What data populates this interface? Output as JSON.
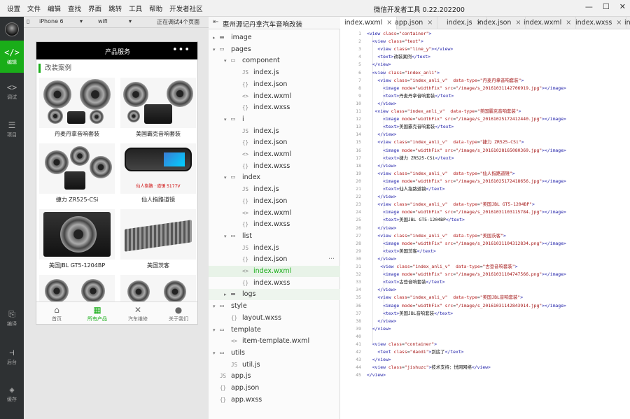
{
  "menu": [
    "设置",
    "文件",
    "编辑",
    "查找",
    "界面",
    "跳转",
    "工具",
    "帮助",
    "开发者社区"
  ],
  "app_title": "微信开发者工具 0.22.202200",
  "window_controls": [
    "minimize-icon",
    "maximize-icon",
    "close-icon"
  ],
  "leftbar": {
    "items": [
      {
        "label": "编辑",
        "icon": "code-icon",
        "active": true
      },
      {
        "label": "调试",
        "icon": "debug-icon",
        "active": false
      },
      {
        "label": "项目",
        "icon": "project-icon",
        "active": false
      },
      {
        "label": "编译",
        "icon": "compile-icon",
        "active": false
      },
      {
        "label": "后台",
        "icon": "backend-icon",
        "active": false
      },
      {
        "label": "缓存",
        "icon": "cache-icon",
        "active": false
      }
    ]
  },
  "simulator": {
    "device": "iPhone 6",
    "network": "wifi",
    "debug_status": "正在调试4个页面",
    "nav_title": "产品服务",
    "nav_menu": "•••",
    "section_title": "改装案例",
    "cards": [
      {
        "label": "丹麦丹拿音响套装"
      },
      {
        "label": "美国霸克音响套装"
      },
      {
        "label": "捷力 ZR525-CSi"
      },
      {
        "label": "仙人指路道镜",
        "banner": "仙人指路 · 道镜 5177V"
      },
      {
        "label": "美国JBL GT5-1204BP"
      },
      {
        "label": "美国茨客"
      }
    ],
    "tabs": [
      {
        "label": "首页",
        "icon": "home-icon",
        "active": false
      },
      {
        "label": "所有产品",
        "icon": "grid-icon",
        "active": true
      },
      {
        "label": "汽车维修",
        "icon": "wrench-icon",
        "active": false
      },
      {
        "label": "关于我们",
        "icon": "user-icon",
        "active": false
      }
    ]
  },
  "explorer": {
    "project_name": "惠州源记丹拿汽车音响改装",
    "rows": [
      {
        "label": "image",
        "type": "folder",
        "depth": 1,
        "open": false
      },
      {
        "label": "pages",
        "type": "folder",
        "depth": 1,
        "open": true
      },
      {
        "label": "component",
        "type": "folder",
        "depth": 2,
        "open": true
      },
      {
        "label": "index.js",
        "type": "js",
        "depth": 3
      },
      {
        "label": "index.json",
        "type": "json",
        "depth": 3
      },
      {
        "label": "index.wxml",
        "type": "wxml",
        "depth": 3
      },
      {
        "label": "index.wxss",
        "type": "wxss",
        "depth": 3
      },
      {
        "label": "i",
        "type": "folder",
        "depth": 2,
        "open": true
      },
      {
        "label": "index.js",
        "type": "js",
        "depth": 3
      },
      {
        "label": "index.json",
        "type": "json",
        "depth": 3
      },
      {
        "label": "index.wxml",
        "type": "wxml",
        "depth": 3
      },
      {
        "label": "index.wxss",
        "type": "wxss",
        "depth": 3
      },
      {
        "label": "index",
        "type": "folder",
        "depth": 2,
        "open": true
      },
      {
        "label": "index.js",
        "type": "js",
        "depth": 3
      },
      {
        "label": "index.json",
        "type": "json",
        "depth": 3
      },
      {
        "label": "index.wxml",
        "type": "wxml",
        "depth": 3
      },
      {
        "label": "index.wxss",
        "type": "wxss",
        "depth": 3
      },
      {
        "label": "list",
        "type": "folder",
        "depth": 2,
        "open": true
      },
      {
        "label": "index.js",
        "type": "js",
        "depth": 3
      },
      {
        "label": "index.json",
        "type": "json",
        "depth": 3,
        "selected": true,
        "more": "···"
      },
      {
        "label": "index.wxml",
        "type": "wxml",
        "depth": 3,
        "active": true
      },
      {
        "label": "index.wxss",
        "type": "wxss",
        "depth": 3
      },
      {
        "label": "logs",
        "type": "folder",
        "depth": 2,
        "open": false,
        "highlight": true
      },
      {
        "label": "style",
        "type": "folder",
        "depth": 1,
        "open": true
      },
      {
        "label": "layout.wxss",
        "type": "wxss",
        "depth": 2
      },
      {
        "label": "template",
        "type": "folder",
        "depth": 1,
        "open": true
      },
      {
        "label": "item-template.wxml",
        "type": "wxml",
        "depth": 2
      },
      {
        "label": "utils",
        "type": "folder",
        "depth": 1,
        "open": true
      },
      {
        "label": "util.js",
        "type": "js",
        "depth": 2
      },
      {
        "label": "app.js",
        "type": "js",
        "depth": 1
      },
      {
        "label": "app.json",
        "type": "json",
        "depth": 1
      },
      {
        "label": "app.wxss",
        "type": "wxss",
        "depth": 1
      }
    ]
  },
  "editor_tabs": [
    {
      "label": "index.wxml",
      "active": true
    },
    {
      "label": "app.json",
      "active": false
    },
    {
      "label": "index.js",
      "active": false
    },
    {
      "label": "index.json",
      "active": false
    },
    {
      "label": "index.wxml",
      "active": false
    },
    {
      "label": "index.wxss",
      "active": false
    },
    {
      "label": "ind",
      "active": false
    }
  ],
  "code_lines": [
    {
      "n": "1",
      "t": "<view class=\"container\">"
    },
    {
      "n": "2",
      "t": "  <view class=\"text\">"
    },
    {
      "n": "3",
      "t": "    <view class=\"line_y\"></view>"
    },
    {
      "n": "4",
      "t": "    <text>改装案例</text>"
    },
    {
      "n": "5",
      "t": "  </view>"
    },
    {
      "n": "6",
      "t": "  <view class=\"index_anli\">"
    },
    {
      "n": "7",
      "t": "    <view class=\"index_anli_v\"  data-type=\"丹麦丹拿音响套装\">"
    },
    {
      "n": "8",
      "t": "      <image mode=\"widthFix\" src=\"/image/s_20161031142706919.jpg\"></image>"
    },
    {
      "n": "9",
      "t": "      <text>丹麦丹拿音响套装</text>"
    },
    {
      "n": "10",
      "t": "    </view>"
    },
    {
      "n": "11",
      "t": "   <view class=\"index_anli_v\"  data-type=\"美国霸克音响套装\">"
    },
    {
      "n": "12",
      "t": "      <image mode=\"widthFix\" src=\"/image/s_20161025172412440.jpg\"></image>"
    },
    {
      "n": "13",
      "t": "      <text>美国霸克音响套装</text>"
    },
    {
      "n": "14",
      "t": "    </view>"
    },
    {
      "n": "15",
      "t": "    <view class=\"index_anli_v\"  data-type=\"捷力 ZR525-CSi\">"
    },
    {
      "n": "16",
      "t": "      <image mode=\"widthFix\" src=\"/image/s_20161028165080369.jpg\"></image>"
    },
    {
      "n": "17",
      "t": "      <text>捷力 ZR525-CSi</text>"
    },
    {
      "n": "18",
      "t": "    </view>"
    },
    {
      "n": "19",
      "t": "    <view class=\"index_anli_v\"  data-type=\"仙人指路道镜\">"
    },
    {
      "n": "20",
      "t": "      <image mode=\"widthFix\" src=\"/image/s_20161025172418656.jpg\"></image>"
    },
    {
      "n": "21",
      "t": "      <text>仙人指路道镜</text>"
    },
    {
      "n": "22",
      "t": "    </view>"
    },
    {
      "n": "23",
      "t": "    <view class=\"index_anli_v\"  data-type=\"美国JBL GT5-1204BP\">"
    },
    {
      "n": "24",
      "t": "      <image mode=\"widthFix\" src=\"/image/s_20161031103115784.jpg\"></image>"
    },
    {
      "n": "25",
      "t": "      <text>美国JBL GT5-1204BP</text>"
    },
    {
      "n": "26",
      "t": "    </view>"
    },
    {
      "n": "27",
      "t": "    <view class=\"index_anli_v\"  data-type=\"美国茨客\">"
    },
    {
      "n": "28",
      "t": "      <image mode=\"widthFix\" src=\"/image/s_20161031104312834.png\"></image>"
    },
    {
      "n": "29",
      "t": "      <text>美国茨客</text>"
    },
    {
      "n": "30",
      "t": "    </view>"
    },
    {
      "n": "31",
      "t": "     <view class=\"index_anli_v\"  data-type=\"古登音响套装\">"
    },
    {
      "n": "32",
      "t": "      <image mode=\"widthFix\" src=\"/image/s_20161031104747566.png\"></image>"
    },
    {
      "n": "33",
      "t": "      <text>古登音响套装</text>"
    },
    {
      "n": "34",
      "t": "    </view>"
    },
    {
      "n": "35",
      "t": "    <view class=\"index_anli_v\"  data-type=\"美国JBL音响套装\">"
    },
    {
      "n": "36",
      "t": "      <image mode=\"widthFix\" src=\"/image/s_20161031142843914.jpg\"></image>"
    },
    {
      "n": "37",
      "t": "      <text>美国JBL音响套装</text>"
    },
    {
      "n": "38",
      "t": "    </view>"
    },
    {
      "n": "39",
      "t": "  </view>"
    },
    {
      "n": "40",
      "t": ""
    },
    {
      "n": "41",
      "t": "  <view class=\"container\">"
    },
    {
      "n": "42",
      "t": "    <text class=\"daodi\">到底了</text>"
    },
    {
      "n": "43",
      "t": "  </view>"
    },
    {
      "n": "44",
      "t": "  <view class=\"jishuzc\">技术支持：悦网网络</view>"
    },
    {
      "n": "45",
      "t": "</view>"
    }
  ],
  "colors": {
    "accent": "#1aad19",
    "sidebar": "#2e3133",
    "tag": "#1a1aa6",
    "attr": "#b41c1c"
  }
}
